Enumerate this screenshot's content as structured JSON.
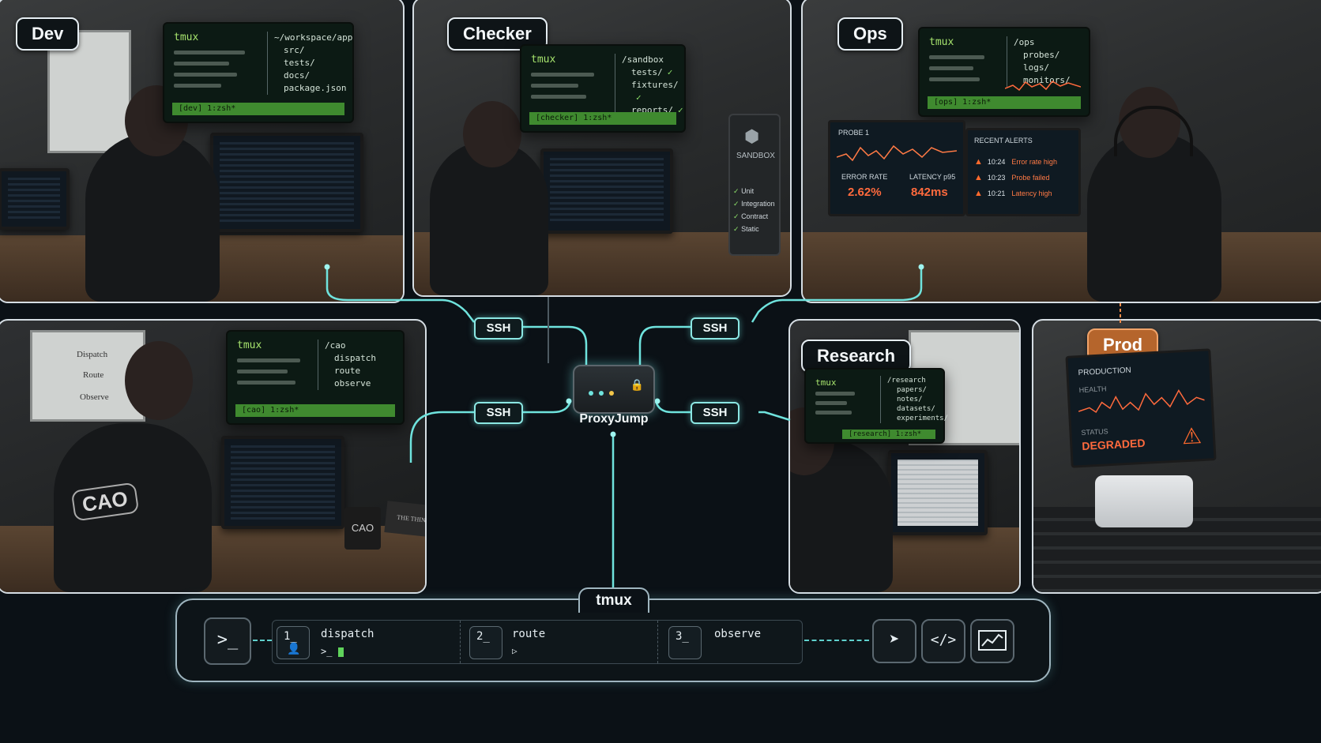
{
  "scenes": {
    "dev": {
      "label": "Dev",
      "tmux": {
        "title": "tmux",
        "path": "~/workspace/app",
        "items": [
          "src/",
          "tests/",
          "docs/",
          "package.json"
        ],
        "status": "[dev] 1:zsh*"
      }
    },
    "checker": {
      "label": "Checker",
      "tmux": {
        "title": "tmux",
        "path": "/sandbox",
        "items": [
          "tests/",
          "fixtures/",
          "reports/"
        ],
        "status": "[checker] 1:zsh*"
      },
      "sandbox": {
        "title": "SANDBOX",
        "checks": [
          "Unit",
          "Integration",
          "Contract",
          "Static"
        ]
      }
    },
    "ops": {
      "label": "Ops",
      "tmux": {
        "title": "tmux",
        "path": "/ops",
        "items": [
          "probes/",
          "logs/",
          "monitors/"
        ],
        "status": "[ops] 1:zsh*"
      },
      "dashboard": {
        "probe_title": "PROBE 1",
        "error_rate_label": "ERROR RATE",
        "error_rate_value": "2.62%",
        "latency_label": "LATENCY p95",
        "latency_value": "842ms",
        "alerts_title": "RECENT ALERTS",
        "alerts": [
          {
            "time": "10:24",
            "text": "Error rate high"
          },
          {
            "time": "10:23",
            "text": "Probe failed"
          },
          {
            "time": "10:21",
            "text": "Latency high"
          }
        ]
      }
    },
    "cao": {
      "tmux": {
        "title": "tmux",
        "path": "/cao",
        "items": [
          "dispatch",
          "route",
          "observe"
        ],
        "status": "[cao] 1:zsh*"
      },
      "whiteboard": [
        "Dispatch",
        "Route",
        "Observe"
      ],
      "hoodie": "CAO",
      "mug": "CAO",
      "book": "THE THIN ORCHESTRATOR"
    },
    "research": {
      "label": "Research",
      "tmux": {
        "title": "tmux",
        "path": "/research",
        "items": [
          "papers/",
          "notes/",
          "datasets/",
          "experiments/"
        ],
        "status": "[research] 1:zsh*"
      }
    },
    "prod": {
      "label": "Prod",
      "monitor": {
        "title": "PRODUCTION",
        "health_label": "HEALTH",
        "status_label": "STATUS",
        "status_value": "DEGRADED"
      }
    }
  },
  "network": {
    "ssh_label": "SSH",
    "proxy_label": "ProxyJump"
  },
  "tmux_bar": {
    "title": "tmux",
    "steps": [
      {
        "num": "1_",
        "label": "dispatch",
        "prompt": ">_"
      },
      {
        "num": "2_",
        "label": "route",
        "prompt": "▷"
      },
      {
        "num": "3_",
        "label": "observe",
        "prompt": ""
      }
    ]
  },
  "colors": {
    "wire": "#6fe3dd",
    "tmux_green": "#3f8a2f",
    "alert_orange": "#ff6a3d",
    "prod_orange": "#b5652c"
  }
}
